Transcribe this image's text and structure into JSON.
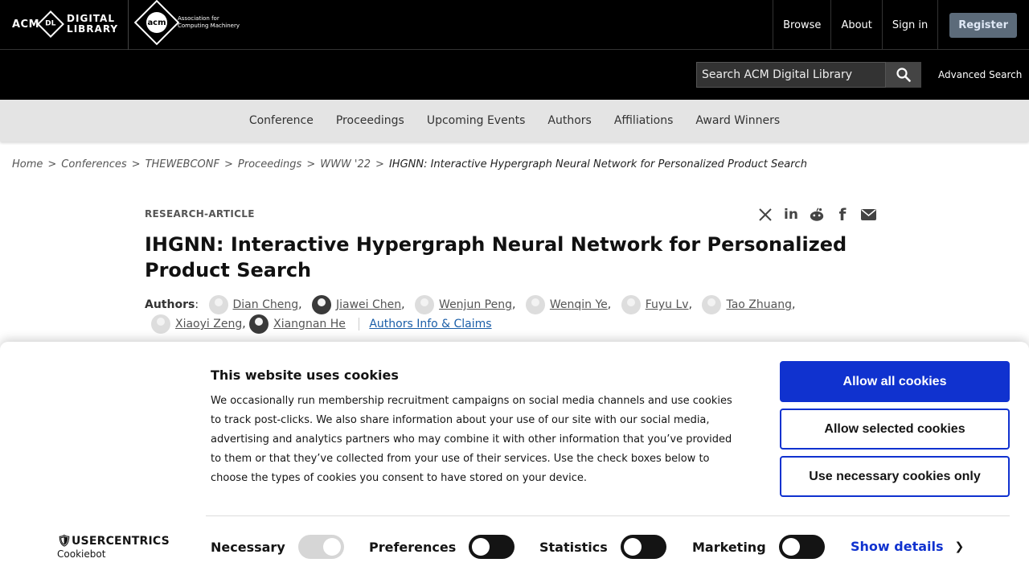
{
  "header": {
    "dl_logo": {
      "acm": "ACM",
      "mark": "DL",
      "line1": "DIGITAL",
      "line2": "LIBRARY"
    },
    "acm_logo": {
      "mark": "acm",
      "line1": "Association for",
      "line2": "Computing Machinery"
    },
    "nav": [
      "Browse",
      "About",
      "Sign in"
    ],
    "register": "Register"
  },
  "search": {
    "placeholder": "Search ACM Digital Library",
    "advanced": "Advanced Search"
  },
  "category_nav": [
    "Conference",
    "Proceedings",
    "Upcoming Events",
    "Authors",
    "Affiliations",
    "Award Winners"
  ],
  "breadcrumb": [
    "Home",
    "Conferences",
    "THEWEBCONF",
    "Proceedings",
    "WWW '22"
  ],
  "breadcrumb_current": "IHGNN: Interactive Hypergraph Neural Network for Personalized Product Search",
  "article": {
    "type": "RESEARCH-ARTICLE",
    "title": "IHGNN: Interactive Hypergraph Neural Network for Personalized Product Search",
    "authors_label": "Authors",
    "authors": [
      "Dian Cheng",
      "Jiawei Chen",
      "Wenjun Peng",
      "Wenqin Ye",
      "Fuyu Lv",
      "Tao Zhuang",
      "Xiaoyi Zeng",
      "Xiangnan He"
    ],
    "authors_info": "Authors Info & Claims",
    "share_icons": [
      "x-icon",
      "linkedin-icon",
      "reddit-icon",
      "facebook-icon",
      "email-icon"
    ]
  },
  "cookie": {
    "title": "This website uses cookies",
    "text": "We occasionally run membership recruitment campaigns on social media channels and use cookies to track post-clicks. We also share information about your use of our site with our social media, advertising and analytics partners who may combine it with other information that you’ve provided to them or that they’ve collected from your use of their services. Use the check boxes below to choose the types of cookies you consent to have stored on your device.",
    "allow_all": "Allow all cookies",
    "allow_selected": "Allow selected cookies",
    "necessary_only": "Use necessary cookies only",
    "brand": "USERCENTRICS",
    "brand_sub": "Cookiebot",
    "toggles": {
      "necessary": "Necessary",
      "preferences": "Preferences",
      "statistics": "Statistics",
      "marketing": "Marketing"
    },
    "show_details": "Show details"
  }
}
